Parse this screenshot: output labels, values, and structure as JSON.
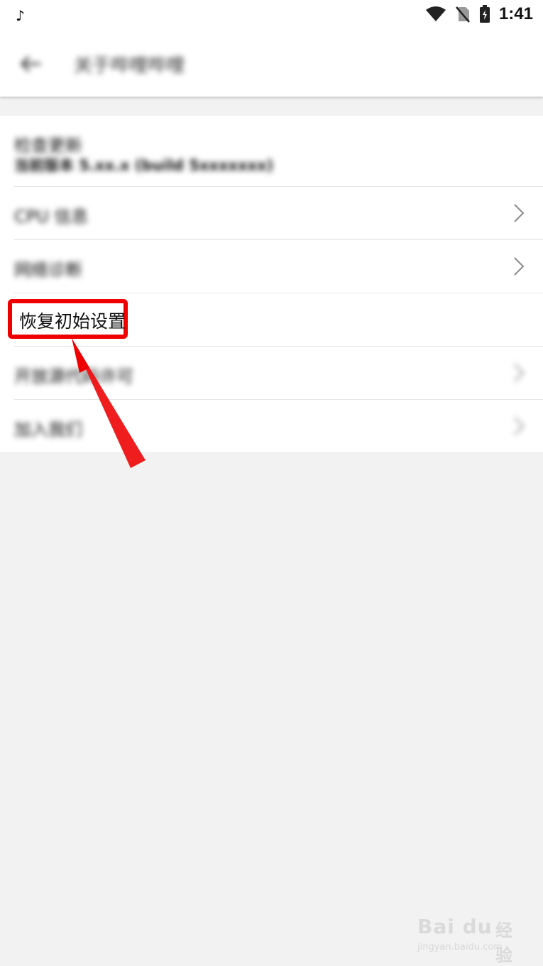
{
  "status_bar": {
    "app_icon": "music-note-icon",
    "time": "1:41",
    "icons": [
      "wifi-icon",
      "no-sim-icon",
      "battery-icon"
    ]
  },
  "app_bar": {
    "back_icon": "back-arrow-icon",
    "title": "关于哔哩哔哩"
  },
  "list": {
    "items": [
      {
        "label": "检查更新",
        "subtitle": "当前版本 5.xx.x (build 5xxxxxxx)",
        "has_chevron": false
      },
      {
        "label": "CPU 信息",
        "has_chevron": true
      },
      {
        "label": "网络诊断",
        "has_chevron": true
      },
      {
        "label": "恢复初始设置",
        "has_chevron": false,
        "highlighted": true
      },
      {
        "label": "开放源代码许可",
        "has_chevron": true
      },
      {
        "label": "加入我们",
        "has_chevron": true
      }
    ]
  },
  "annotation": {
    "color": "#ee0000"
  },
  "watermark": {
    "logo": "Bai du",
    "text": "经验",
    "url": "jingyan.baidu.com"
  }
}
